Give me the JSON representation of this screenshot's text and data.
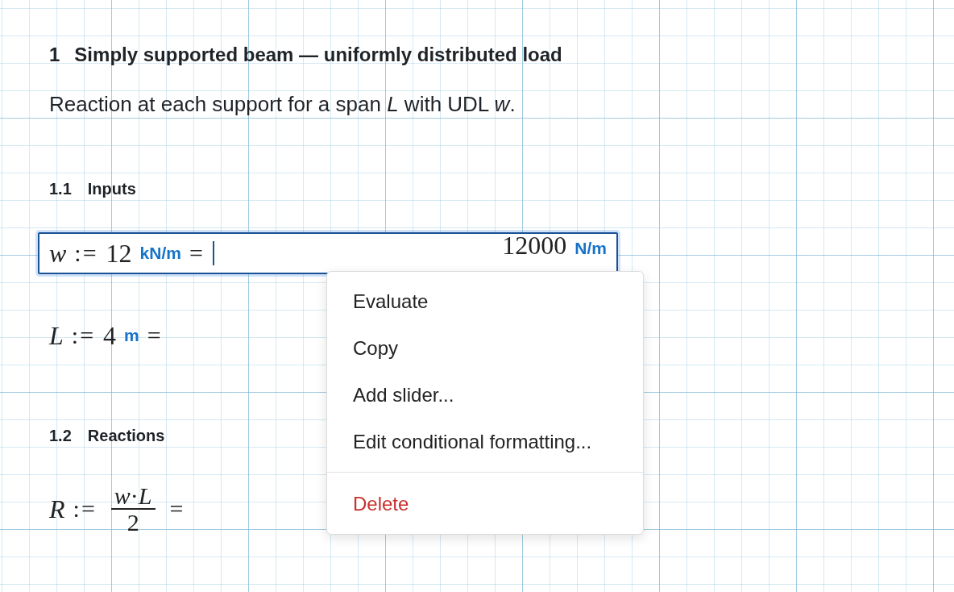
{
  "heading": {
    "number": "1",
    "title": "Simply supported beam — uniformly distributed load"
  },
  "description": "Reaction at each support for a span *L* with UDL *w*.",
  "blocks": [
    {
      "kind": "subheading",
      "number": "1.1",
      "title": "Inputs"
    },
    {
      "kind": "assignment",
      "variable": "w",
      "assign": ":=",
      "value": "12",
      "unit": "kN/m",
      "equals": "=",
      "focused": true,
      "result": "12000",
      "result_unit": "N/m"
    },
    {
      "kind": "assignment",
      "variable": "L",
      "assign": ":=",
      "value": "4",
      "unit": "m",
      "equals": "=",
      "focused": false
    },
    {
      "kind": "subheading",
      "number": "1.2",
      "title": "Reactions"
    },
    {
      "kind": "fraction",
      "variable": "R",
      "assign": ":=",
      "numerator": "*w*·*L*",
      "denominator": "2",
      "equals": "="
    }
  ],
  "context_menu": [
    {
      "label": "Evaluate",
      "kind": "normal"
    },
    {
      "label": "Copy",
      "kind": "normal"
    },
    {
      "label": "Add slider...",
      "kind": "normal"
    },
    {
      "label": "Edit conditional formatting...",
      "kind": "normal"
    },
    {
      "kind": "divider"
    },
    {
      "label": "Delete",
      "kind": "danger"
    }
  ]
}
